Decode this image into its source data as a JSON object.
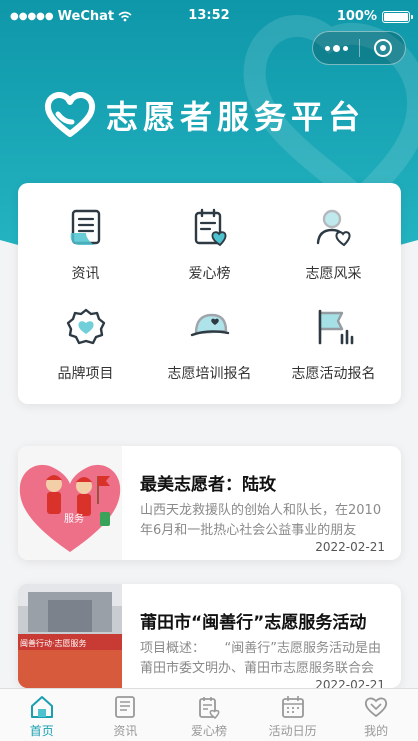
{
  "status_bar": {
    "carrier": "WeChat",
    "time": "13:52",
    "battery": "100%"
  },
  "app": {
    "title": "志愿者服务平台"
  },
  "colors": {
    "primary": "#1a9fb0",
    "header_gradient_top": "#0f9aac",
    "header_gradient_bottom": "#23b5c2",
    "icon_dark": "#2d3a44",
    "icon_accent": "#4ec3cf"
  },
  "menu": {
    "items": [
      {
        "label": "资讯",
        "icon": "news-icon"
      },
      {
        "label": "爱心榜",
        "icon": "heart-board-icon"
      },
      {
        "label": "志愿风采",
        "icon": "volunteer-profile-icon"
      },
      {
        "label": "品牌项目",
        "icon": "brand-badge-icon"
      },
      {
        "label": "志愿培训报名",
        "icon": "training-cap-icon"
      },
      {
        "label": "志愿活动报名",
        "icon": "activity-flag-icon"
      }
    ]
  },
  "news": [
    {
      "title": "最美志愿者：陆玫",
      "desc": "山西天龙救援队的创始人和队长，在2010年6月和一批热心社会公益事业的朋友",
      "date": "2022-02-21",
      "thumb_caption": "服务"
    },
    {
      "title": "莆田市“闽善行”志愿服务活动",
      "desc": "项目概述：　　“闽善行”志愿服务活动是由莆田市委文明办、莆田市志愿服务联合会",
      "date": "2022-02-21",
      "thumb_caption": "闽善行动·志愿服务"
    }
  ],
  "tabbar": {
    "items": [
      {
        "label": "首页",
        "icon": "home-icon",
        "active": true
      },
      {
        "label": "资讯",
        "icon": "news-icon",
        "active": false
      },
      {
        "label": "爱心榜",
        "icon": "heart-board-icon",
        "active": false
      },
      {
        "label": "活动日历",
        "icon": "calendar-icon",
        "active": false
      },
      {
        "label": "我的",
        "icon": "profile-heart-icon",
        "active": false
      }
    ]
  }
}
